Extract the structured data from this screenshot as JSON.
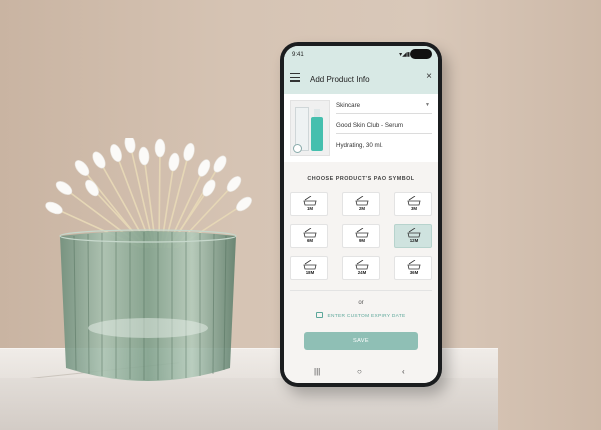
{
  "status_bar": {
    "time": "9:41",
    "icons": "▾◢▮"
  },
  "app_bar": {
    "title": "Add Product Info",
    "menu_icon": "hamburger-icon",
    "close_icon": "close-icon",
    "close_glyph": "×"
  },
  "product": {
    "category": "Skincare",
    "name": "Good Skin Club - Serum",
    "description": "Hydrating, 30 ml."
  },
  "pao_section": {
    "heading": "CHOOSE PRODUCT'S PAO SYMBOL",
    "options": [
      "1M",
      "2M",
      "3M",
      "6M",
      "9M",
      "12M",
      "18M",
      "24M",
      "36M"
    ],
    "selected": "12M"
  },
  "or_label": "or",
  "custom_expiry_label": "ENTER CUSTOM EXPIRY DATE",
  "save_label": "SAVE",
  "nav": {
    "recent": "|||",
    "home": "○",
    "back": "‹"
  },
  "colors": {
    "accent": "#5ca79a",
    "button": "#8fbfb5",
    "header": "#d8e9e5",
    "selected": "#cfe3df"
  }
}
